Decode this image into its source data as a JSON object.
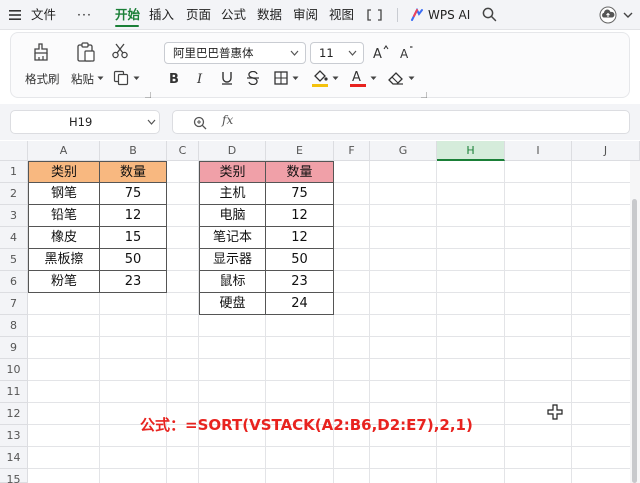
{
  "menubar": {
    "file": "文件",
    "more": "···",
    "tabs": [
      "开始",
      "插入",
      "页面",
      "公式",
      "数据",
      "审阅",
      "视图"
    ],
    "wps_ai": "WPS AI",
    "colors": {
      "active": "#1a7f37"
    }
  },
  "ribbon": {
    "format_painter": "格式刷",
    "paste": "粘贴",
    "font_name": "阿里巴巴普惠体",
    "font_size": "11"
  },
  "formula_bar": {
    "cell_ref": "H19",
    "fx": "fx",
    "formula": ""
  },
  "sheet": {
    "columns": [
      "A",
      "B",
      "C",
      "D",
      "E",
      "F",
      "G",
      "H",
      "I",
      "J"
    ],
    "rows": [
      "1",
      "2",
      "3",
      "4",
      "5",
      "6",
      "7",
      "8",
      "9",
      "10",
      "11",
      "12",
      "13",
      "14",
      "15"
    ],
    "selected_column": "H",
    "table1": {
      "headers": [
        "类别",
        "数量"
      ],
      "rows": [
        [
          "钢笔",
          "75"
        ],
        [
          "铅笔",
          "12"
        ],
        [
          "橡皮",
          "15"
        ],
        [
          "黑板擦",
          "50"
        ],
        [
          "粉笔",
          "23"
        ]
      ],
      "header_color": "#f8b880"
    },
    "table2": {
      "headers": [
        "类别",
        "数量"
      ],
      "rows": [
        [
          "主机",
          "75"
        ],
        [
          "电脑",
          "12"
        ],
        [
          "笔记本",
          "12"
        ],
        [
          "显示器",
          "50"
        ],
        [
          "鼠标",
          "23"
        ],
        [
          "硬盘",
          "24"
        ]
      ],
      "header_color": "#f0a0a8"
    },
    "note": "公式：=SORT(VSTACK(A2:B6,D2:E7),2,1)",
    "note_color": "#e8231f"
  }
}
